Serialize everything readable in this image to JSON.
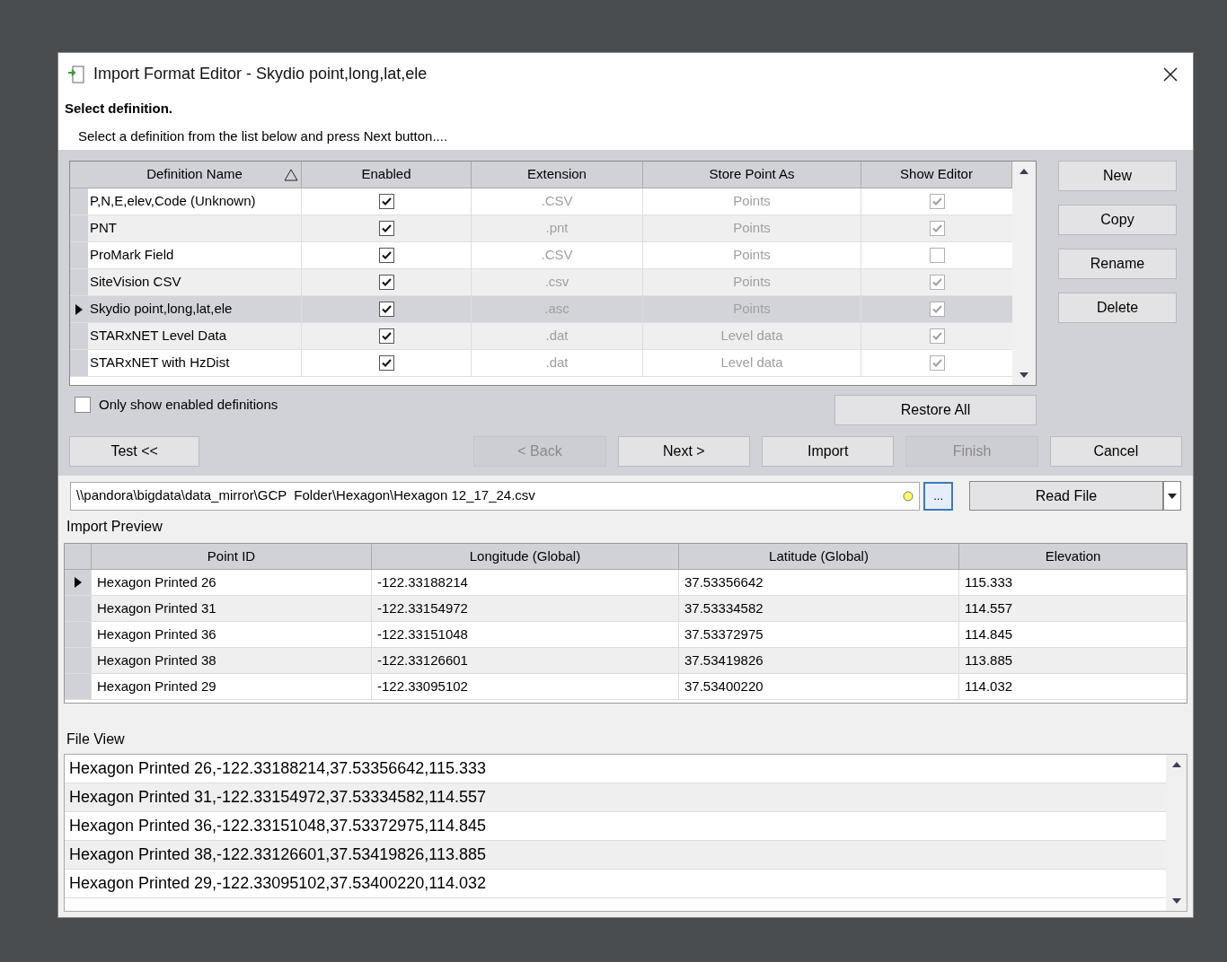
{
  "window": {
    "title": "Import Format Editor - Skydio point,long,lat,ele"
  },
  "heading": "Select definition.",
  "instruction": "Select a definition from the list below and press Next button....",
  "definitions": {
    "columns": [
      "Definition Name",
      "Enabled",
      "Extension",
      "Store Point As",
      "Show Editor"
    ],
    "rows": [
      {
        "name": "P,N,E,elev,Code (Unknown)",
        "enabled": true,
        "extension": ".CSV",
        "store_as": "Points",
        "show_editor": true,
        "selected": false
      },
      {
        "name": "PNT",
        "enabled": true,
        "extension": ".pnt",
        "store_as": "Points",
        "show_editor": true,
        "selected": false
      },
      {
        "name": "ProMark Field",
        "enabled": true,
        "extension": ".CSV",
        "store_as": "Points",
        "show_editor": false,
        "selected": false
      },
      {
        "name": "SiteVision CSV",
        "enabled": true,
        "extension": ".csv",
        "store_as": "Points",
        "show_editor": true,
        "selected": false
      },
      {
        "name": "Skydio point,long,lat,ele",
        "enabled": true,
        "extension": ".asc",
        "store_as": "Points",
        "show_editor": true,
        "selected": true
      },
      {
        "name": "STARxNET Level Data",
        "enabled": true,
        "extension": ".dat",
        "store_as": "Level data",
        "show_editor": true,
        "selected": false
      },
      {
        "name": "STARxNET with HzDist",
        "enabled": true,
        "extension": ".dat",
        "store_as": "Level data",
        "show_editor": true,
        "selected": false
      }
    ]
  },
  "side_buttons": [
    "New",
    "Copy",
    "Rename",
    "Delete"
  ],
  "only_enabled": {
    "label": "Only show enabled definitions",
    "checked": false
  },
  "restore_button": "Restore All",
  "test_button": "Test <<",
  "nav_buttons": [
    {
      "label": "< Back",
      "disabled": true
    },
    {
      "label": "Next >",
      "disabled": false
    },
    {
      "label": "Import",
      "disabled": false
    },
    {
      "label": "Finish",
      "disabled": true
    },
    {
      "label": "Cancel",
      "disabled": false
    }
  ],
  "file_path": "\\\\pandora\\bigdata\\data_mirror\\GCP  Folder\\Hexagon\\Hexagon 12_17_24.csv",
  "browse_button": "...",
  "read_button": "Read File",
  "preview": {
    "title": "Import Preview",
    "columns": [
      "Point ID",
      "Longitude (Global)",
      "Latitude (Global)",
      "Elevation"
    ],
    "rows": [
      {
        "cells": [
          "Hexagon Printed 26",
          "-122.33188214",
          "37.53356642",
          "115.333"
        ],
        "selected": true
      },
      {
        "cells": [
          "Hexagon Printed 31",
          "-122.33154972",
          "37.53334582",
          "114.557"
        ],
        "selected": false
      },
      {
        "cells": [
          "Hexagon Printed 36",
          "-122.33151048",
          "37.53372975",
          "114.845"
        ],
        "selected": false
      },
      {
        "cells": [
          "Hexagon Printed 38",
          "-122.33126601",
          "37.53419826",
          "113.885"
        ],
        "selected": false
      },
      {
        "cells": [
          "Hexagon Printed 29",
          "-122.33095102",
          "37.53400220",
          "114.032"
        ],
        "selected": false
      }
    ]
  },
  "file_view": {
    "title": "File View",
    "lines": [
      "Hexagon Printed 26,-122.33188214,37.53356642,115.333",
      "Hexagon Printed 31,-122.33154972,37.53334582,114.557",
      "Hexagon Printed 36,-122.33151048,37.53372975,114.845",
      "Hexagon Printed 38,-122.33126601,37.53419826,113.885",
      "Hexagon Printed 29,-122.33095102,37.53400220,114.032"
    ]
  }
}
